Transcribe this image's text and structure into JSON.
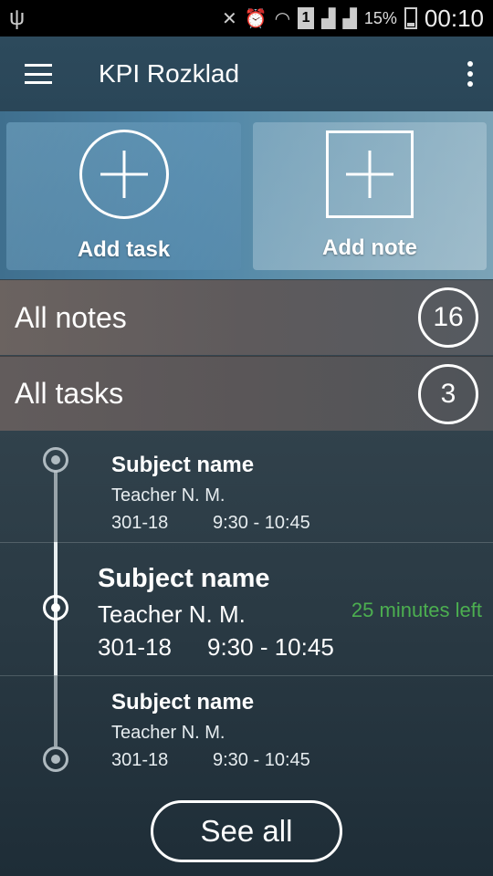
{
  "status_bar": {
    "usb_icon": "usb-icon",
    "battery_percent": "15%",
    "sim_label": "1",
    "time": "00:10"
  },
  "app_bar": {
    "title": "KPI Rozklad",
    "menu_icon": "hamburger-icon",
    "overflow_icon": "more-vert-icon"
  },
  "tiles": {
    "add_task": "Add task",
    "add_note": "Add note"
  },
  "summary": {
    "notes_label": "All notes",
    "notes_count": "16",
    "tasks_label": "All tasks",
    "tasks_count": "3"
  },
  "lessons": [
    {
      "subject": "Subject name",
      "teacher": "Teacher N. M.",
      "room": "301-18",
      "time": "9:30 - 10:45",
      "status": ""
    },
    {
      "subject": "Subject name",
      "teacher": "Teacher N. M.",
      "room": "301-18",
      "time": "9:30 - 10:45",
      "status": "25 minutes left"
    },
    {
      "subject": "Subject name",
      "teacher": "Teacher N. M.",
      "room": "301-18",
      "time": "9:30 - 10:45",
      "status": ""
    }
  ],
  "see_all_label": "See all",
  "colors": {
    "status_green": "#4caf50",
    "app_bar": "#2d4a5c"
  }
}
